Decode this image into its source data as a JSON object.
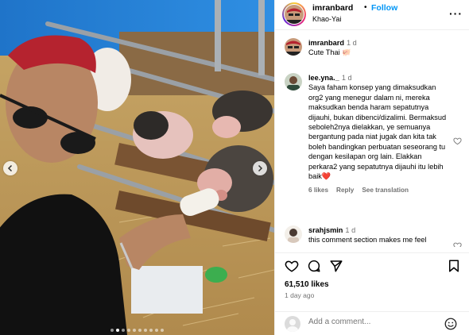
{
  "post": {
    "username": "imranbard",
    "separator": "•",
    "follow_label": "Follow",
    "location": "Khao-Yai",
    "more_label": "···"
  },
  "comments": [
    {
      "username": "imranbard",
      "time": "1 d",
      "text": "Cute Thai 🐖"
    },
    {
      "username": "lee.yna._",
      "time": "1 d",
      "text": "Saya faham konsep yang dimaksudkan org2 yang menegur dalam ni, mereka maksudkan benda haram sepatutnya dijauhi, bukan dibenci/dizalimi. Bermaksud seboleh2nya dielakkan, ye semuanya bergantung pada niat jugak dan kita tak boleh bandingkan perbuatan seseorang tu dengan kesilapan org lain. Elakkan perkara2 yang sepatutnya dijauhi itu lebih baik❤️",
      "likes": "6 likes",
      "reply": "Reply",
      "translate": "See translation"
    },
    {
      "username": "srahjsmin",
      "time": "1 d",
      "text": "this comment section makes me feel"
    }
  ],
  "actions": {
    "likes": "61,510 likes",
    "ago": "1 day ago"
  },
  "add_comment": {
    "placeholder": "Add a comment..."
  },
  "icons": {
    "prev": "chevron-left-icon",
    "next": "chevron-right-icon",
    "like": "heart-icon",
    "comment": "comment-icon",
    "share": "send-icon",
    "save": "bookmark-icon",
    "emoji": "smiley-icon"
  },
  "colors": {
    "accent": "#0095f6",
    "muted": "#737373",
    "heart_red": "#ed4956"
  },
  "carousel": {
    "slides": 10,
    "active": 1
  }
}
